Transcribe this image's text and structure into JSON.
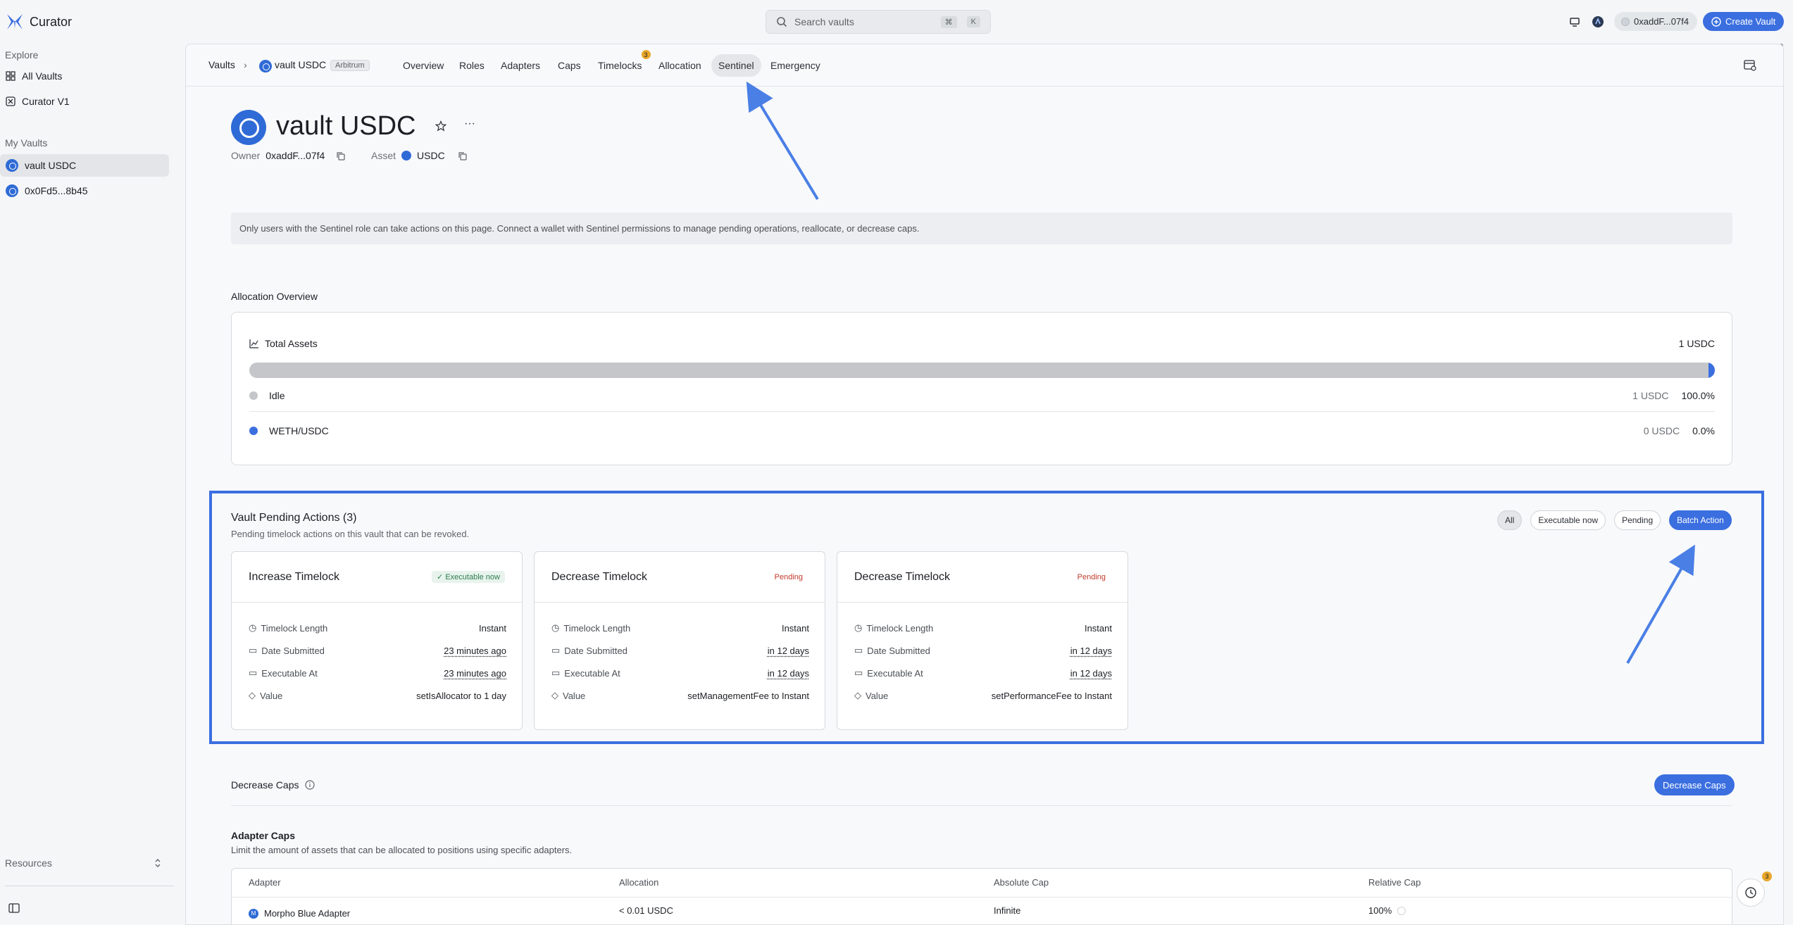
{
  "app": {
    "name": "Curator"
  },
  "search": {
    "placeholder": "Search vaults",
    "shortcut_mod": "⌘",
    "shortcut_key": "K"
  },
  "header": {
    "wallet": "0xaddF...07f4",
    "create_label": "Create Vault"
  },
  "sidebar": {
    "explore_label": "Explore",
    "explore_items": [
      {
        "label": "All Vaults"
      },
      {
        "label": "Curator V1"
      }
    ],
    "my_vaults_label": "My Vaults",
    "my_vaults": [
      {
        "label": "vault USDC"
      },
      {
        "label": "0x0Fd5...8b45"
      }
    ],
    "resources_label": "Resources"
  },
  "breadcrumb": {
    "root": "Vaults",
    "vault": "vault USDC",
    "network": "Arbitrum"
  },
  "tabs": [
    {
      "label": "Overview"
    },
    {
      "label": "Roles"
    },
    {
      "label": "Adapters"
    },
    {
      "label": "Caps"
    },
    {
      "label": "Timelocks",
      "badge": "3"
    },
    {
      "label": "Allocation"
    },
    {
      "label": "Sentinel"
    },
    {
      "label": "Emergency"
    }
  ],
  "active_tab": "Sentinel",
  "vault": {
    "title": "vault USDC",
    "owner_label": "Owner",
    "owner": "0xaddF...07f4",
    "asset_label": "Asset",
    "asset": "USDC"
  },
  "notice": "Only users with the Sentinel role can take actions on this page. Connect a wallet with Sentinel permissions to manage pending operations, reallocate, or decrease caps.",
  "allocation_overview": {
    "title": "Allocation Overview",
    "total_label": "Total Assets",
    "total_value": "1 USDC",
    "idle_fraction": 1.0,
    "items": [
      {
        "label": "Idle",
        "amount": "1 USDC",
        "pct": "100.0%",
        "color": "#c4c6c9"
      },
      {
        "label": "WETH/USDC",
        "amount": "0 USDC",
        "pct": "0.0%",
        "color": "#3b6fe0"
      }
    ]
  },
  "pending_actions": {
    "title": "Vault Pending Actions (3)",
    "subtitle": "Pending timelock actions on this vault that can be revoked.",
    "filters": [
      "All",
      "Executable now",
      "Pending"
    ],
    "batch_label": "Batch Action",
    "row_labels": {
      "length": "Timelock Length",
      "submitted": "Date Submitted",
      "executable": "Executable At",
      "value": "Value"
    },
    "cards": [
      {
        "title": "Increase Timelock",
        "status": "Executable now",
        "length": "Instant",
        "submitted": "23 minutes ago",
        "executable": "23 minutes ago",
        "value": "setIsAllocator to 1 day"
      },
      {
        "title": "Decrease Timelock",
        "status": "Pending",
        "length": "Instant",
        "submitted": "in 12 days",
        "executable": "in 12 days",
        "value": "setManagementFee to Instant"
      },
      {
        "title": "Decrease Timelock",
        "status": "Pending",
        "length": "Instant",
        "submitted": "in 12 days",
        "executable": "in 12 days",
        "value": "setPerformanceFee to Instant"
      }
    ]
  },
  "decrease_caps": {
    "title": "Decrease Caps",
    "button": "Decrease Caps"
  },
  "adapter_caps": {
    "title": "Adapter Caps",
    "subtitle": "Limit the amount of assets that can be allocated to positions using specific adapters.",
    "columns": [
      "Adapter",
      "Allocation",
      "Absolute Cap",
      "Relative Cap"
    ],
    "rows": [
      {
        "adapter": "Morpho Blue Adapter",
        "allocation": "< 0.01 USDC",
        "absolute": "Infinite",
        "relative": "100%"
      }
    ]
  },
  "history_badge": "3",
  "colors": {
    "accent": "#3b6fe0",
    "annotation": "#4a7fe6",
    "pending": "#c0392b",
    "executable": "#2e7d4f",
    "badge": "#e9a72b"
  }
}
